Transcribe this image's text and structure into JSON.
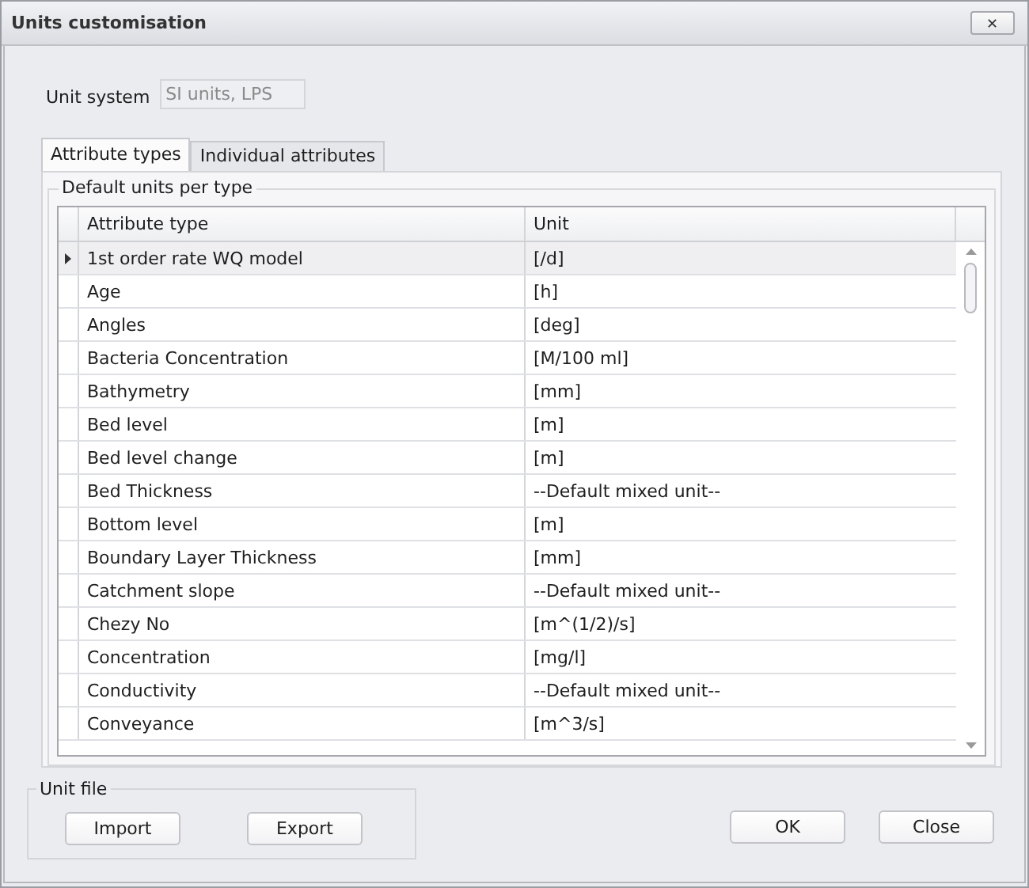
{
  "window": {
    "title": "Units customisation",
    "close_label": "✕"
  },
  "unit_system": {
    "label": "Unit system",
    "value": "SI units, LPS"
  },
  "tabs": [
    {
      "label": "Attribute types",
      "selected": true
    },
    {
      "label": "Individual attributes",
      "selected": false
    }
  ],
  "group": {
    "title": "Default units per type"
  },
  "table": {
    "columns": [
      "Attribute type",
      "Unit"
    ],
    "rows": [
      {
        "attribute_type": "1st order rate WQ model",
        "unit": "[/d]",
        "selected": true
      },
      {
        "attribute_type": "Age",
        "unit": "[h]",
        "selected": false
      },
      {
        "attribute_type": "Angles",
        "unit": "[deg]",
        "selected": false
      },
      {
        "attribute_type": "Bacteria Concentration",
        "unit": "[M/100 ml]",
        "selected": false
      },
      {
        "attribute_type": "Bathymetry",
        "unit": "[mm]",
        "selected": false
      },
      {
        "attribute_type": "Bed level",
        "unit": "[m]",
        "selected": false
      },
      {
        "attribute_type": "Bed level change",
        "unit": "[m]",
        "selected": false
      },
      {
        "attribute_type": "Bed Thickness",
        "unit": "--Default mixed unit--",
        "selected": false
      },
      {
        "attribute_type": "Bottom level",
        "unit": "[m]",
        "selected": false
      },
      {
        "attribute_type": "Boundary Layer Thickness",
        "unit": "[mm]",
        "selected": false
      },
      {
        "attribute_type": "Catchment slope",
        "unit": "--Default mixed unit--",
        "selected": false
      },
      {
        "attribute_type": "Chezy No",
        "unit": "[m^(1/2)/s]",
        "selected": false
      },
      {
        "attribute_type": "Concentration",
        "unit": "[mg/l]",
        "selected": false
      },
      {
        "attribute_type": "Conductivity",
        "unit": "--Default mixed unit--",
        "selected": false
      },
      {
        "attribute_type": "Conveyance",
        "unit": "[m^3/s]",
        "selected": false
      }
    ]
  },
  "unit_file": {
    "title": "Unit file",
    "buttons": [
      "Import",
      "Export"
    ]
  },
  "buttons": [
    "OK",
    "Close"
  ]
}
